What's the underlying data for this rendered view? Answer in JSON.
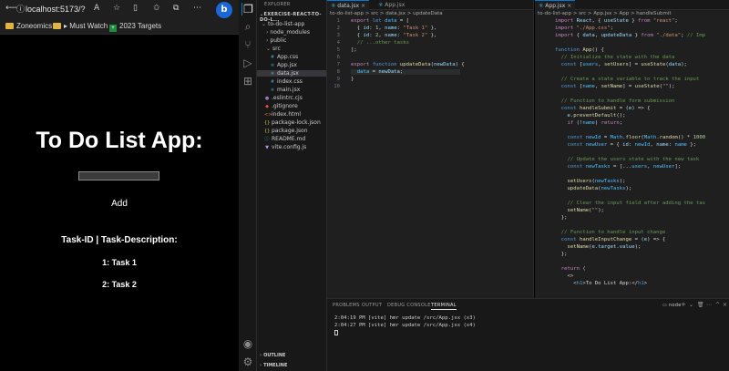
{
  "browser": {
    "url": "localhost:5173/?",
    "read_aloud": "A",
    "bookmarks": [
      "Zoneomics",
      "Must Watch",
      "2023 Targets"
    ],
    "bing_label": "b",
    "app": {
      "title": "To Do List App:",
      "input_value": "",
      "add_label": "Add",
      "list_header": "Task-ID | Task-Description:",
      "tasks": [
        "1: Task 1",
        "2: Task 2"
      ]
    }
  },
  "vscode": {
    "explorer_title": "EXPLORER",
    "workspace_title": "EXERCISE-REACT-TO-DO-L...",
    "tree": [
      {
        "label": "to-do-list-app",
        "kind": "folder"
      },
      {
        "label": "node_modules",
        "kind": "folder"
      },
      {
        "label": "public",
        "kind": "folder"
      },
      {
        "label": "src",
        "kind": "folder"
      },
      {
        "label": "App.css",
        "kind": "css"
      },
      {
        "label": "App.jsx",
        "kind": "jsx"
      },
      {
        "label": "data.jsx",
        "kind": "jsx"
      },
      {
        "label": "index.css",
        "kind": "css"
      },
      {
        "label": "main.jsx",
        "kind": "jsx"
      },
      {
        "label": ".eslintrc.cjs",
        "kind": "eslint"
      },
      {
        "label": ".gitignore",
        "kind": "git"
      },
      {
        "label": "index.html",
        "kind": "html"
      },
      {
        "label": "package-lock.json",
        "kind": "json"
      },
      {
        "label": "package.json",
        "kind": "json"
      },
      {
        "label": "README.md",
        "kind": "md"
      },
      {
        "label": "vite.config.js",
        "kind": "js"
      }
    ],
    "outline_label": "OUTLINE",
    "timeline_label": "TIMELINE",
    "editor1": {
      "tabs": [
        "data.jsx",
        "App.jsx"
      ],
      "breadcrumb": "to-do-list-app > src > data.jsx > updateData",
      "line_numbers": [
        "1",
        "2",
        "3",
        "4",
        "5",
        "6",
        "7",
        "8",
        "9",
        "10"
      ]
    },
    "editor2": {
      "tabs": [
        "App.jsx"
      ],
      "breadcrumb": "to-do-list-app > src > App.jsx > App > handleSubmit"
    },
    "panel": {
      "tabs": [
        "PROBLEMS",
        "OUTPUT",
        "DEBUG CONSOLE",
        "TERMINAL"
      ],
      "active_tab": "TERMINAL",
      "shell": "node",
      "lines": [
        "2:04:19 PM [vite] hmr update /src/App.jsx (x3)",
        "2:04:27 PM [vite] hmr update /src/App.jsx (x4)"
      ]
    },
    "colors": {
      "accent": "#0078d4",
      "keyword": "#c586c0",
      "function": "#dcdcaa",
      "string": "#ce9178",
      "variable": "#9cdcfe",
      "comment": "#6a9955"
    }
  }
}
